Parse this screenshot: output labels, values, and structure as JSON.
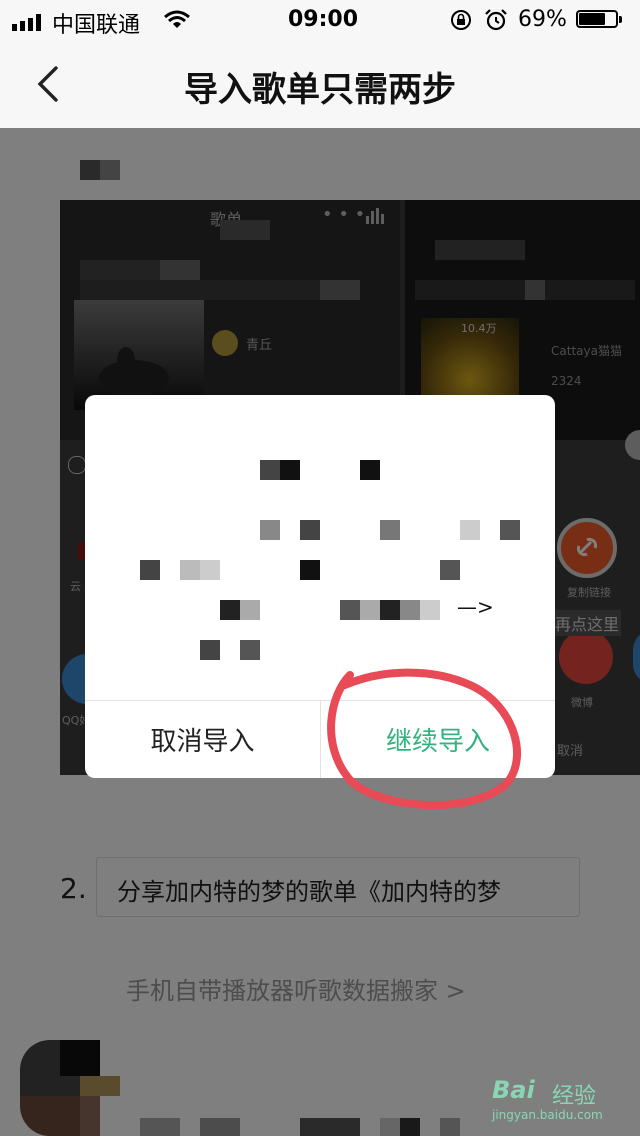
{
  "status": {
    "carrier": "中国联通",
    "time": "09:00",
    "battery_percent": "69%",
    "battery_level": 0.69
  },
  "nav": {
    "title": "导入歌单只需两步"
  },
  "screenshot": {
    "left_title": "歌单",
    "right_badge": "10.4万",
    "right_user": "Cattaya猫猫",
    "right_count": "2324",
    "left_user": "青丘",
    "share_copy_link": "复制链接",
    "share_weibo": "微博",
    "share_cancel": "取消",
    "share_hint": "再点这里"
  },
  "dialog": {
    "cancel_label": "取消导入",
    "continue_label": "继续导入",
    "arrow_text": "—>"
  },
  "step2": {
    "number": "2.",
    "text": "分享加内特的梦的歌单《加内特的梦"
  },
  "link": {
    "text": "手机自带播放器听歌数据搬家 >"
  },
  "watermark": {
    "brand": "Bai",
    "product": "经验",
    "url": "jingyan.baidu.com"
  },
  "colors": {
    "accent_green": "#33b27f",
    "annotation_red": "#e84a56",
    "share_orange": "#f15a2b",
    "share_weibo_red": "#e8463f"
  }
}
